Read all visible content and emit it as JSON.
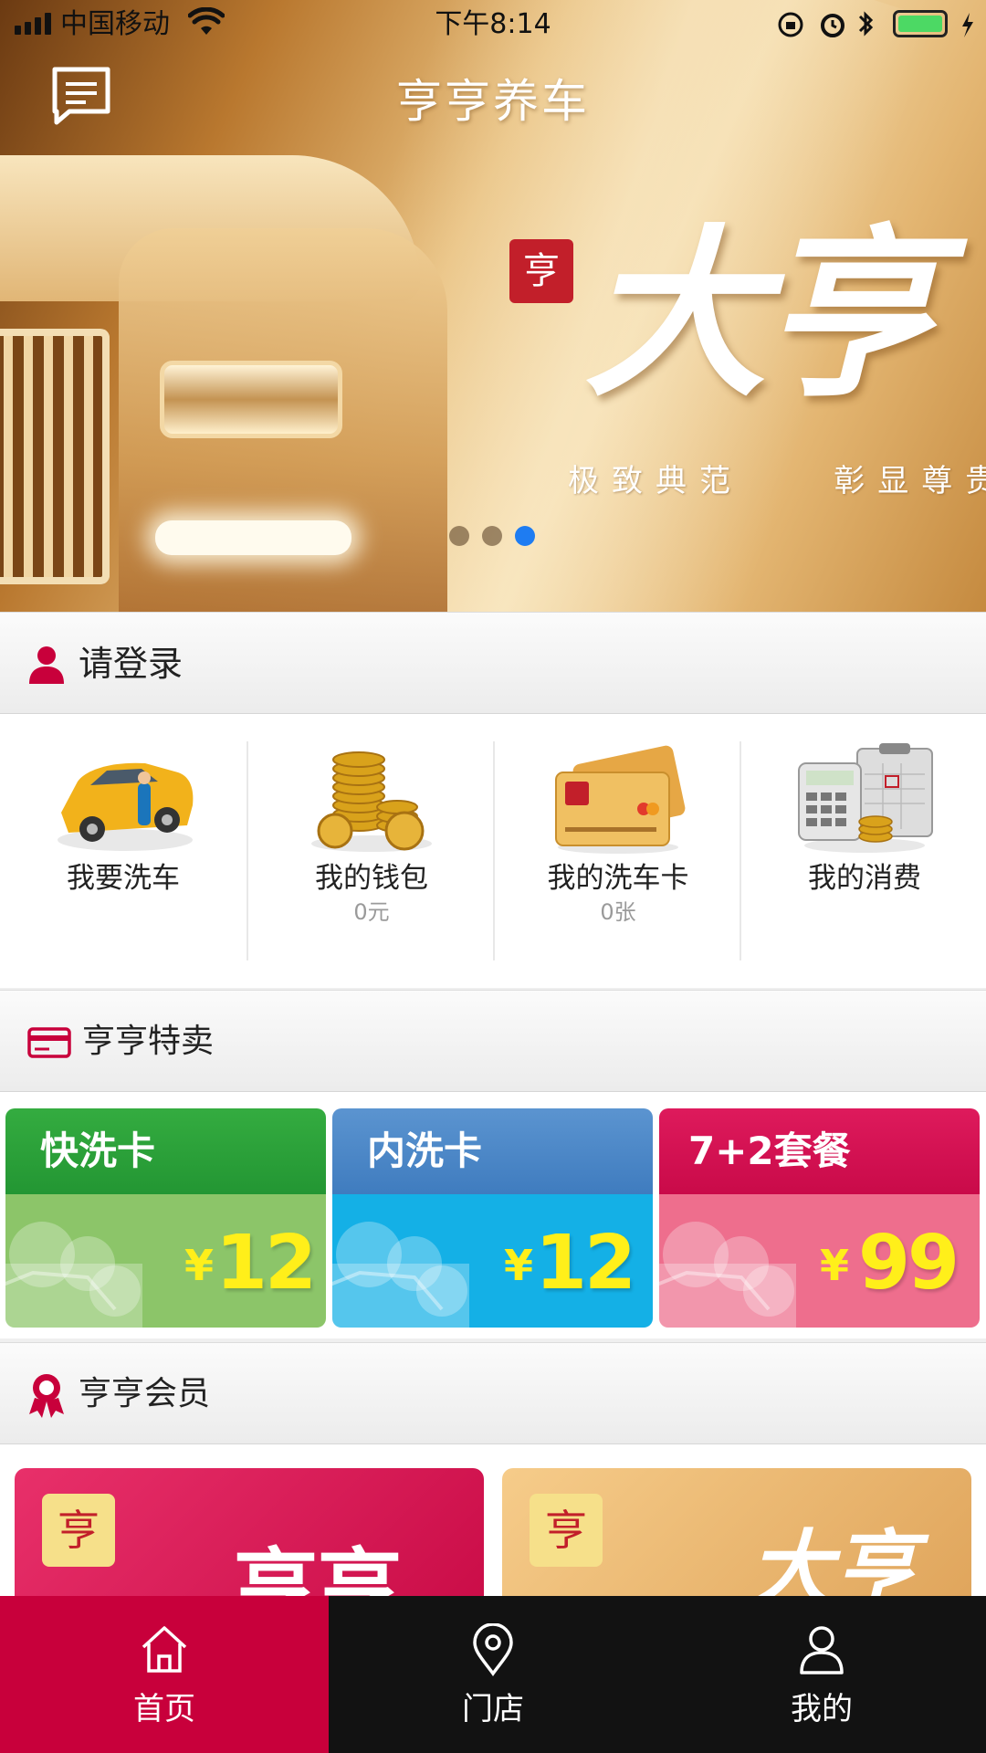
{
  "status_bar": {
    "carrier": "中国移动",
    "time": "下午8:14",
    "battery_color": "#4cd964"
  },
  "header": {
    "title": "亨亨养车",
    "menu_icon": "message-list-icon"
  },
  "banner": {
    "logo_char": "亨",
    "headline": "大亨",
    "tagline": "极致典范    彰显尊贵",
    "slide_count": 3,
    "active_slide": 3
  },
  "login_section": {
    "label": "请登录",
    "icon": "user-icon"
  },
  "quick_actions": [
    {
      "label": "我要洗车",
      "sub": "",
      "icon": "car-wash-icon"
    },
    {
      "label": "我的钱包",
      "sub": "0元",
      "icon": "coins-icon"
    },
    {
      "label": "我的洗车卡",
      "sub": "0张",
      "icon": "card-icon"
    },
    {
      "label": "我的消费",
      "sub": "",
      "icon": "calculator-icon"
    }
  ],
  "special_section": {
    "label": "亨亨特卖",
    "icon": "credit-card-icon"
  },
  "promos": [
    {
      "title": "快洗卡",
      "currency": "¥",
      "price": "12",
      "top_color": "#2fa13a",
      "bottom_color": "#8cc569"
    },
    {
      "title": "内洗卡",
      "currency": "¥",
      "price": "12",
      "top_color": "#4a86c6",
      "bottom_color": "#14b0e6"
    },
    {
      "title": "7+2套餐",
      "currency": "¥",
      "price": "99",
      "top_color": "#d40e52",
      "bottom_color": "#ee6e8d"
    }
  ],
  "member_section": {
    "label": "亨亨会员",
    "icon": "award-ribbon-icon"
  },
  "member_cards": [
    {
      "logo_char": "亨",
      "text": "亨亨",
      "color": "#d8114b"
    },
    {
      "logo_char": "亨",
      "text": "大亨",
      "color": "#e7b46a"
    }
  ],
  "tabbar": {
    "tabs": [
      {
        "label": "首页",
        "icon": "home-icon",
        "active": true
      },
      {
        "label": "门店",
        "icon": "location-pin-icon",
        "active": false
      },
      {
        "label": "我的",
        "icon": "person-icon",
        "active": false
      }
    ],
    "active_color": "#c8003b"
  }
}
